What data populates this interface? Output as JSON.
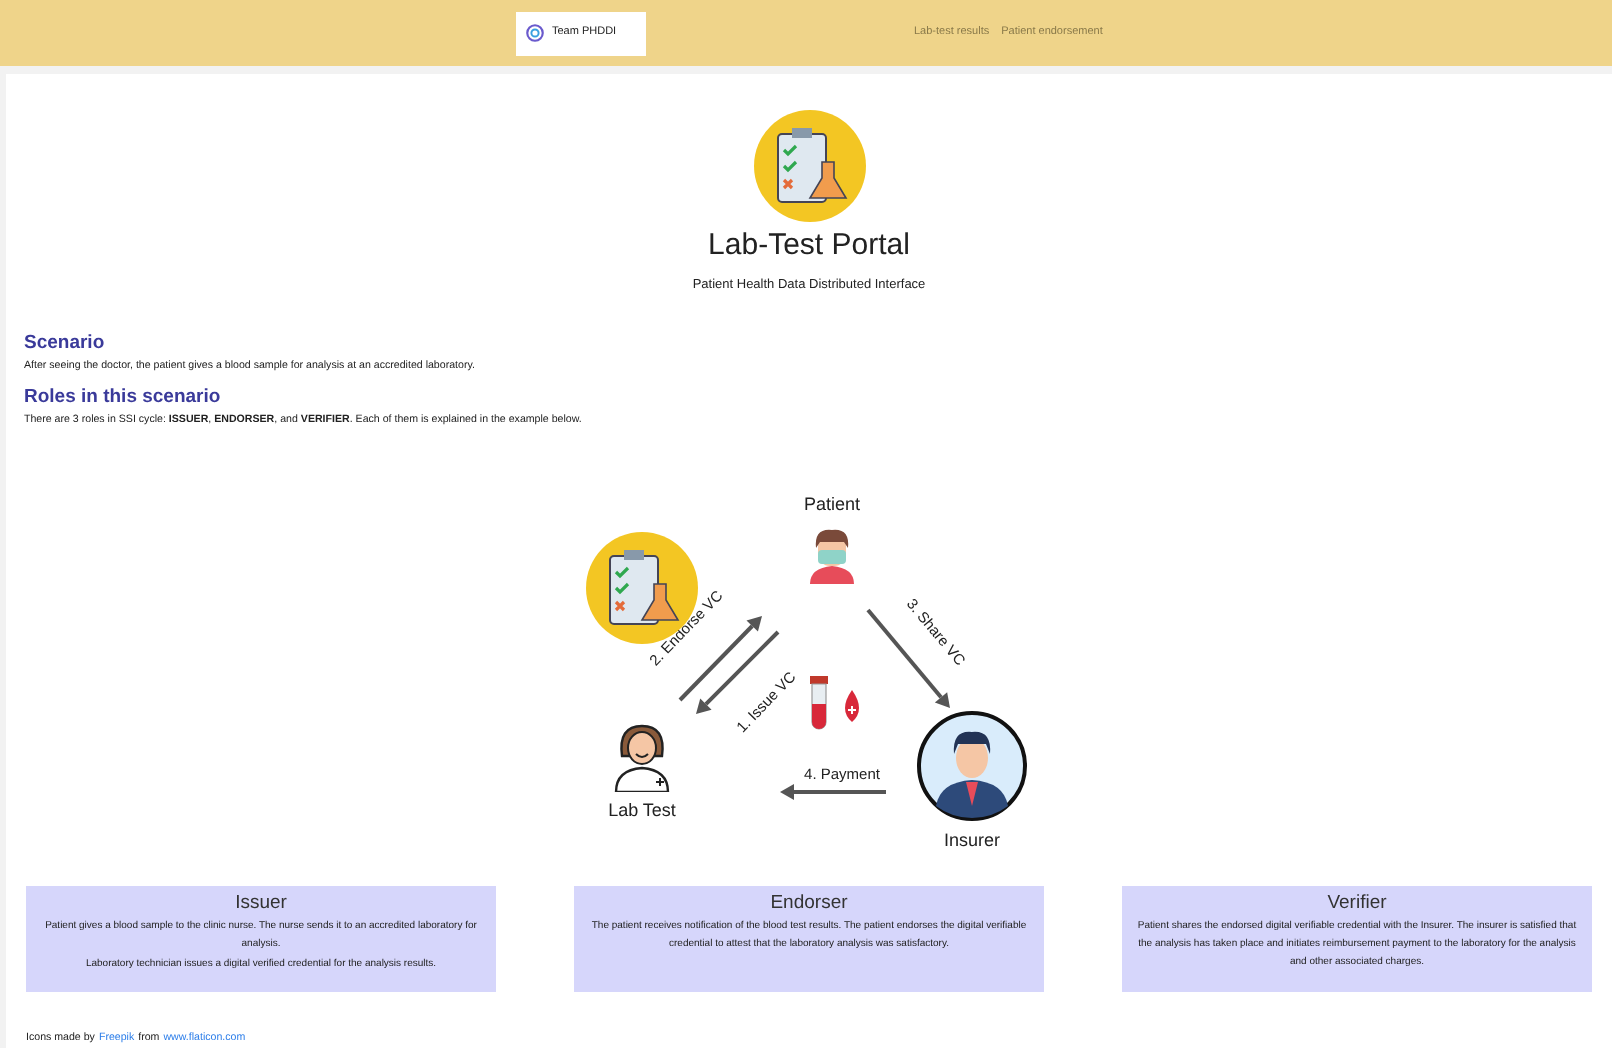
{
  "navbar": {
    "brand": "Team PHDDI",
    "links": [
      "Lab-test results",
      "Patient endorsement"
    ]
  },
  "header": {
    "title": "Lab-Test Portal",
    "subtitle": "Patient Health Data Distributed Interface"
  },
  "sections": [
    {
      "heading": "Scenario",
      "text": "After seeing the doctor, the patient gives a blood sample for analysis at an accredited laboratory."
    },
    {
      "heading": "Roles in this scenario",
      "text": "There are 3 roles in SSI cycle: **ISSUER**, **ENDORSER**, and **VERIFIER**. Each of them is explained in the example below."
    }
  ],
  "diagram": {
    "nodes": [
      {
        "kind": "patient",
        "label": "Patient"
      },
      {
        "kind": "lab",
        "label": "Lab Test"
      },
      {
        "kind": "insurer",
        "label": "Insurer"
      }
    ],
    "arrows": [
      {
        "kind": "endorse",
        "label": "2. Endorse VC"
      },
      {
        "kind": "issue",
        "label": "1. Issue VC"
      },
      {
        "kind": "share",
        "label": "3. Share VC"
      },
      {
        "kind": "payment",
        "label": "4. Payment"
      }
    ]
  },
  "cards": [
    {
      "title": "Issuer",
      "lines": [
        "Patient gives a blood sample to the clinic nurse. The nurse sends it to an accredited laboratory for analysis.",
        "Laboratory technician issues a digital verified credential for the analysis results."
      ]
    },
    {
      "title": "Endorser",
      "lines": [
        "The patient receives notification of the blood test results. The patient endorses the digital verifiable credential to attest that the laboratory analysis was satisfactory."
      ]
    },
    {
      "title": "Verifier",
      "lines": [
        "Patient shares the endorsed digital verifiable credential with the Insurer. The insurer is satisfied that the analysis has taken place and initiates reimbursement payment to the laboratory for the analysis and other associated charges."
      ]
    }
  ],
  "credit": {
    "prefix": "Icons made by",
    "author": "Freepik",
    "middle": "from",
    "site": "www.flaticon.com"
  }
}
